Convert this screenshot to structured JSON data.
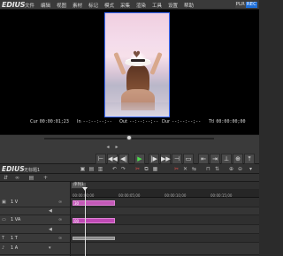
{
  "app": {
    "logo": "EDIUS",
    "menu": [
      "文件",
      "编辑",
      "视图",
      "素材",
      "标记",
      "模式",
      "采集",
      "渲染",
      "工具",
      "设置",
      "帮助"
    ],
    "plr": [
      "PLR",
      "REC"
    ]
  },
  "timecodes": {
    "cur_label": "Cur",
    "cur_value": "00:00:01;23",
    "in_label": "In",
    "in_value": "--:--:--;--",
    "out_label": "Out",
    "out_value": "--:--:--;--",
    "dur_label": "Dur",
    "dur_value": "--:--:--;--",
    "ttl_label": "Ttl",
    "ttl_value": "00:00:00;00"
  },
  "playback": {
    "buttons": [
      "⊢",
      "◀◀",
      "◀|",
      "▶",
      "|▶",
      "▶▶",
      "⊣",
      "▭"
    ],
    "extra": [
      "⇤",
      "⇥",
      "⊥",
      "⊕",
      "⤒"
    ]
  },
  "timeline": {
    "logo": "EDIUS",
    "sequence_name": "无标题1",
    "seq_tab": "序列1",
    "ruler_ticks": [
      "00:00:00;00",
      "00:00:05;00",
      "00:00:10;00",
      "00:00:15;00"
    ],
    "tracks": [
      {
        "label": "1 V",
        "clip": "30"
      },
      {
        "label": "1 VA",
        "clip": "00"
      },
      {
        "label": "1 T",
        "clip": ""
      },
      {
        "label": "1 A",
        "clip": ""
      }
    ]
  },
  "colors": {
    "accent": "#3d6cff",
    "clip": "#c45ab8",
    "play": "#4fdc4f"
  }
}
